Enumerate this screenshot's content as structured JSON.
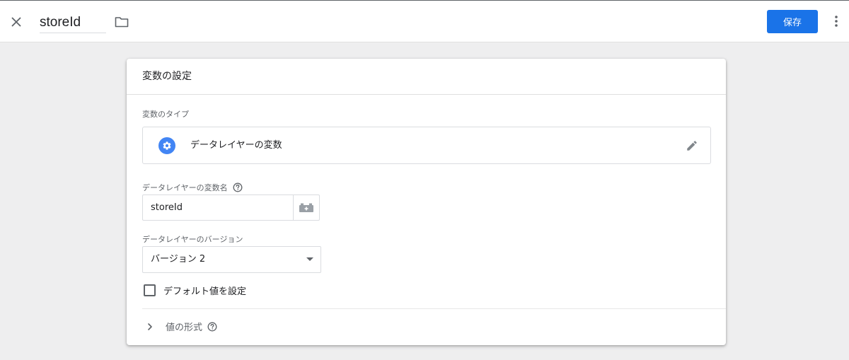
{
  "header": {
    "variable_name": "storeId",
    "save_label": "保存"
  },
  "card": {
    "title": "変数の設定",
    "type_section_label": "変数のタイプ",
    "type_name": "データレイヤーの変数",
    "name_label": "データレイヤーの変数名",
    "name_value": "storeId",
    "version_label": "データレイヤーのバージョン",
    "version_value": "バージョン 2",
    "default_checkbox_label": "デフォルト値を設定",
    "format_label": "値の形式"
  },
  "icons": {
    "close": "close-icon",
    "folder": "folder-icon",
    "more": "more-vert-icon",
    "gear": "gear-icon",
    "pencil": "pencil-icon",
    "help": "help-icon",
    "brick": "variable-picker-icon",
    "chevron": "chevron-right-icon"
  },
  "colors": {
    "primary": "#1a73e8",
    "type_badge": "#4285f4",
    "background": "#eeeeef"
  }
}
